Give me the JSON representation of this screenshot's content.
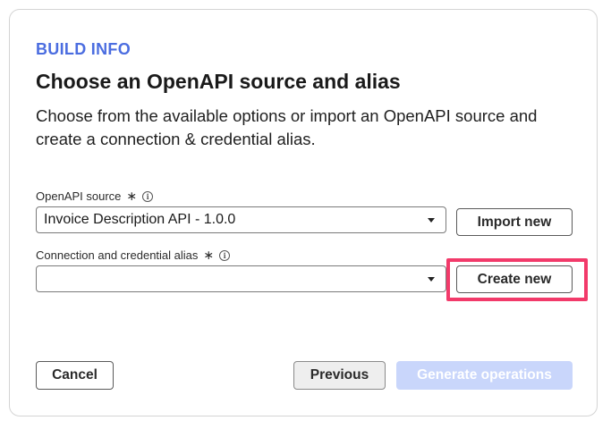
{
  "header": {
    "eyebrow": "BUILD INFO",
    "title": "Choose an OpenAPI source and alias",
    "description": "Choose from the available options or import an OpenAPI source and create a connection & credential alias."
  },
  "openapi_source": {
    "label": "OpenAPI source",
    "required_marker": "∗",
    "info_glyph": "i",
    "selected_value": "Invoice Description API - 1.0.0",
    "import_button": "Import new"
  },
  "alias": {
    "label": "Connection and credential alias",
    "required_marker": "∗",
    "info_glyph": "i",
    "selected_value": "",
    "create_button": "Create new"
  },
  "footer": {
    "cancel": "Cancel",
    "previous": "Previous",
    "generate": "Generate operations"
  },
  "colors": {
    "accent": "#4b6de0",
    "highlight": "#f23a6a",
    "disabled_button": "#c9d6fb"
  }
}
